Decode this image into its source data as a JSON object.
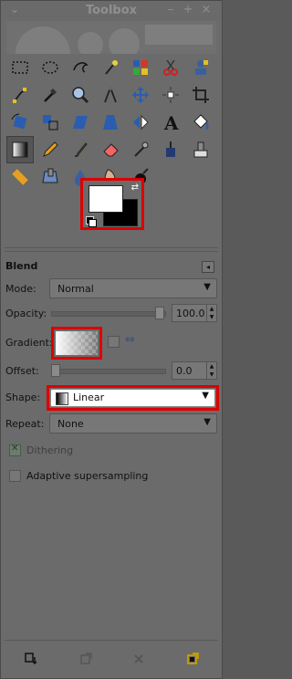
{
  "window": {
    "title": "Toolbox",
    "controls": [
      "–",
      "+",
      "×"
    ]
  },
  "tools": [
    {
      "name": "rect-select-icon"
    },
    {
      "name": "ellipse-select-icon"
    },
    {
      "name": "free-select-icon"
    },
    {
      "name": "fuzzy-select-icon"
    },
    {
      "name": "by-color-select-icon"
    },
    {
      "name": "scissors-select-icon"
    },
    {
      "name": "foreground-select-icon"
    },
    {
      "name": "paths-icon"
    },
    {
      "name": "color-picker-icon"
    },
    {
      "name": "zoom-icon"
    },
    {
      "name": "measure-icon"
    },
    {
      "name": "move-icon"
    },
    {
      "name": "align-icon"
    },
    {
      "name": "crop-icon"
    },
    {
      "name": "rotate-icon"
    },
    {
      "name": "scale-icon"
    },
    {
      "name": "shear-icon"
    },
    {
      "name": "perspective-icon"
    },
    {
      "name": "flip-icon"
    },
    {
      "name": "text-icon"
    },
    {
      "name": "bucket-fill-icon"
    },
    {
      "name": "blend-icon",
      "active": true
    },
    {
      "name": "pencil-icon"
    },
    {
      "name": "paintbrush-icon"
    },
    {
      "name": "eraser-icon"
    },
    {
      "name": "airbrush-icon"
    },
    {
      "name": "ink-icon"
    },
    {
      "name": "clone-icon"
    },
    {
      "name": "heal-icon"
    },
    {
      "name": "perspective-clone-icon"
    },
    {
      "name": "blur-sharpen-icon"
    },
    {
      "name": "smudge-icon"
    },
    {
      "name": "dodge-burn-icon"
    }
  ],
  "colors": {
    "foreground": "#ffffff",
    "background": "#000000",
    "highlight": "#dd0000"
  },
  "options": {
    "title": "Blend",
    "mode_label": "Mode:",
    "mode_value": "Normal",
    "opacity_label": "Opacity:",
    "opacity_value": "100.0",
    "gradient_label": "Gradient:",
    "offset_label": "Offset:",
    "offset_value": "0.0",
    "shape_label": "Shape:",
    "shape_value": "Linear",
    "repeat_label": "Repeat:",
    "repeat_value": "None",
    "dithering_label": "Dithering",
    "dithering_checked": true,
    "adaptive_label": "Adaptive supersampling",
    "adaptive_checked": false,
    "opacity_level": 1.0,
    "offset_level": 0.0
  },
  "bottom": {
    "buttons": [
      "save-options-icon",
      "restore-options-icon",
      "delete-options-icon",
      "reset-options-icon"
    ]
  }
}
